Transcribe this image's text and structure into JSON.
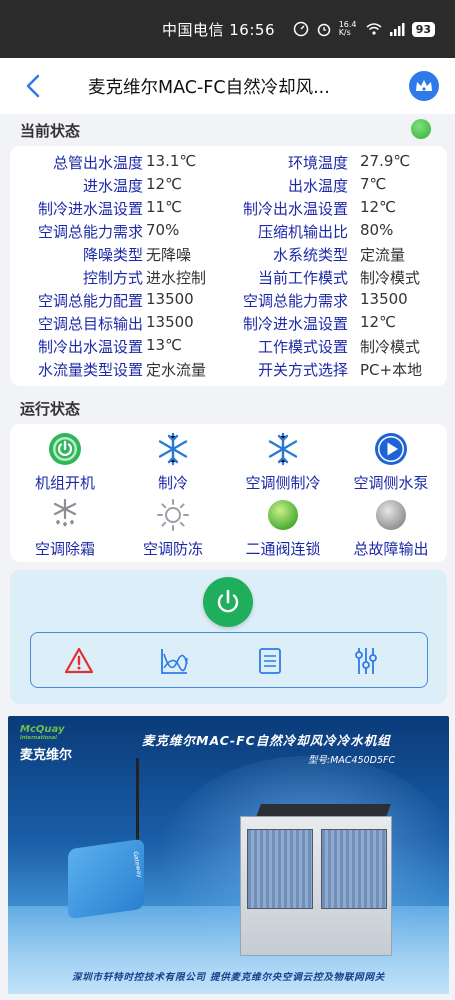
{
  "statusbar": {
    "carrier_time": "中国电信 16:56",
    "speed": "16.4 K/s",
    "battery": "93"
  },
  "header": {
    "title": "麦克维尔MAC-FC自然冷却风..."
  },
  "sections": {
    "current_status": "当前状态",
    "running_status": "运行状态"
  },
  "status_rows": [
    {
      "k1": "总管出水温度",
      "v1": "13.1℃",
      "k2": "环境温度",
      "v2": "27.9℃"
    },
    {
      "k1": "进水温度",
      "v1": "12℃",
      "k2": "出水温度",
      "v2": "7℃"
    },
    {
      "k1": "制冷进水温设置",
      "v1": "11℃",
      "k2": "制冷出水温设置",
      "v2": "12℃"
    },
    {
      "k1": "空调总能力需求",
      "v1": "70%",
      "k2": "压缩机输出比",
      "v2": "80%"
    },
    {
      "k1": "降噪类型",
      "v1": "无降噪",
      "k2": "水系统类型",
      "v2": "定流量"
    },
    {
      "k1": "控制方式",
      "v1": "进水控制",
      "k2": "当前工作模式",
      "v2": "制冷模式"
    },
    {
      "k1": "空调总能力配置",
      "v1": "13500",
      "k2": "空调总能力需求",
      "v2": "13500"
    },
    {
      "k1": "空调总目标输出",
      "v1": "13500",
      "k2": "制冷进水温设置",
      "v2": "12℃"
    },
    {
      "k1": "制冷出水温设置",
      "v1": "13℃",
      "k2": "工作模式设置",
      "v2": "制冷模式"
    },
    {
      "k1": "水流量类型设置",
      "v1": "定水流量",
      "k2": "开关方式选择",
      "v2": "PC+本地"
    }
  ],
  "run_items": [
    {
      "label": "机组开机",
      "icon": "power-on-icon"
    },
    {
      "label": "制冷",
      "icon": "snowflake-icon"
    },
    {
      "label": "空调侧制冷",
      "icon": "snowflake-icon"
    },
    {
      "label": "空调侧水泵",
      "icon": "play-icon"
    },
    {
      "label": "空调除霜",
      "icon": "defrost-icon"
    },
    {
      "label": "空调防冻",
      "icon": "sun-icon"
    },
    {
      "label": "二通阀连锁",
      "icon": "green-dot-icon"
    },
    {
      "label": "总故障输出",
      "icon": "gray-dot-icon"
    }
  ],
  "colors": {
    "label_blue": "#1d2aa8",
    "accent_blue": "#2e7be8",
    "power_green": "#1fae5c",
    "alarm_red": "#e0312e"
  },
  "banner": {
    "brand_en": "McQuay",
    "brand_en_sub": "International",
    "brand_cn": "麦克维尔",
    "title": "麦克维尔MAC-FC自然冷却风冷冷水机组",
    "model": "型号:MAC450D5FC",
    "gateway_label": "Gateway",
    "footer": "深圳市轩特时控技术有限公司   提供麦克维尔央空调云控及物联网网关"
  }
}
